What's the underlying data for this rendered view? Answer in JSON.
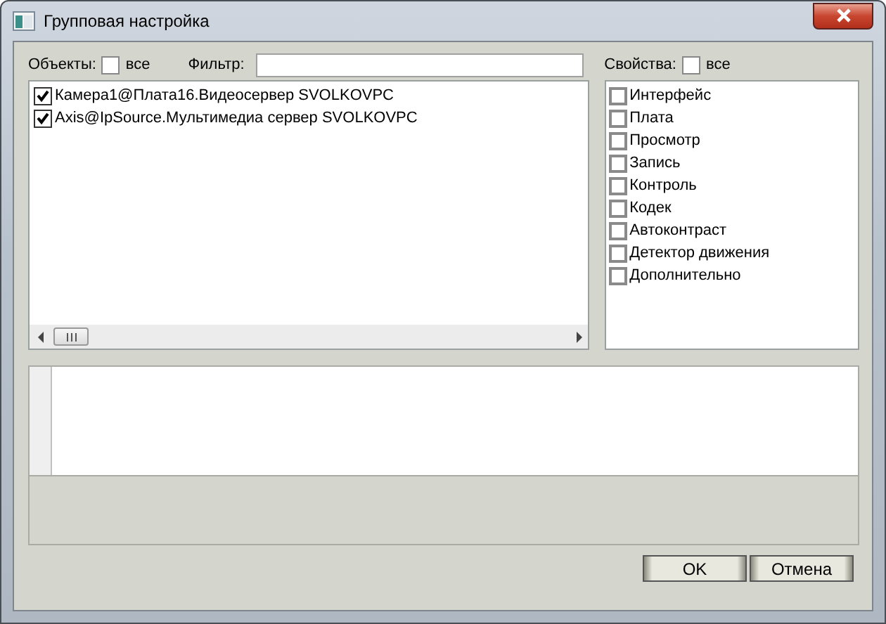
{
  "window": {
    "title": "Групповая настройка"
  },
  "objects": {
    "label": "Объекты:",
    "all_label": "все",
    "all_checked": false,
    "filter_label": "Фильтр:",
    "items": [
      {
        "label": "Камера1@Плата16.Видеосервер SVOLKOVPC",
        "checked": true
      },
      {
        "label": "Axis@IpSource.Мультимедиа сервер SVOLKOVPC",
        "checked": true
      }
    ]
  },
  "properties": {
    "label": "Свойства:",
    "all_label": "все",
    "all_checked": false,
    "items": [
      {
        "label": "Интерфейс",
        "checked": false
      },
      {
        "label": "Плата",
        "checked": false
      },
      {
        "label": "Просмотр",
        "checked": false
      },
      {
        "label": "Запись",
        "checked": false
      },
      {
        "label": "Контроль",
        "checked": false
      },
      {
        "label": "Кодек",
        "checked": false
      },
      {
        "label": "Автоконтраст",
        "checked": false
      },
      {
        "label": "Детектор движения",
        "checked": false
      },
      {
        "label": "Дополнительно",
        "checked": false
      }
    ]
  },
  "buttons": [
    "OK",
    "Отмена"
  ]
}
